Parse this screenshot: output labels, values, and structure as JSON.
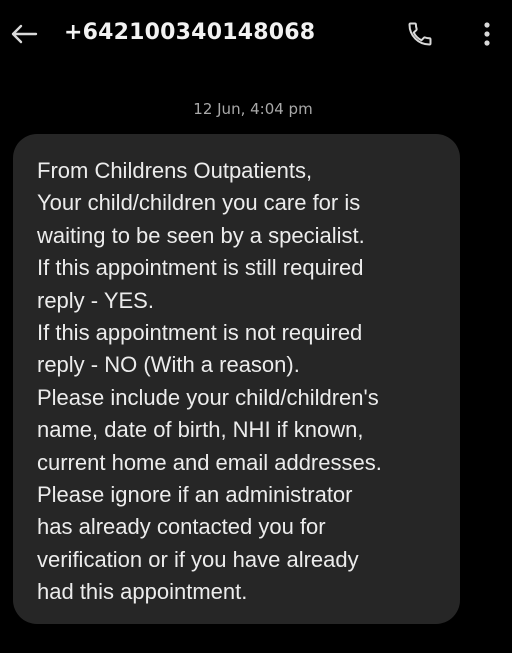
{
  "header": {
    "back_icon": "arrow-left-icon",
    "title": "+642100340148068",
    "call_icon": "phone-icon",
    "more_icon": "more-vertical-icon"
  },
  "conversation": {
    "timestamp": "12 Jun, 4:04 pm",
    "message": {
      "lines": [
        "From Childrens Outpatients,",
        "Your child/children you care for is",
        "waiting to be seen by a specialist.",
        "If this appointment is still required",
        "reply - YES.",
        "If this appointment is not required",
        "reply - NO (With a reason).",
        "Please include your child/children's",
        "name, date of birth, NHI if known,",
        "current home and email addresses.",
        "Please ignore if an administrator",
        "has already contacted you for",
        "verification or if you have already",
        "had this appointment."
      ]
    }
  },
  "colors": {
    "background": "#000000",
    "bubble": "#262626",
    "text": "#ececec",
    "timestamp": "#a9a9a9"
  }
}
